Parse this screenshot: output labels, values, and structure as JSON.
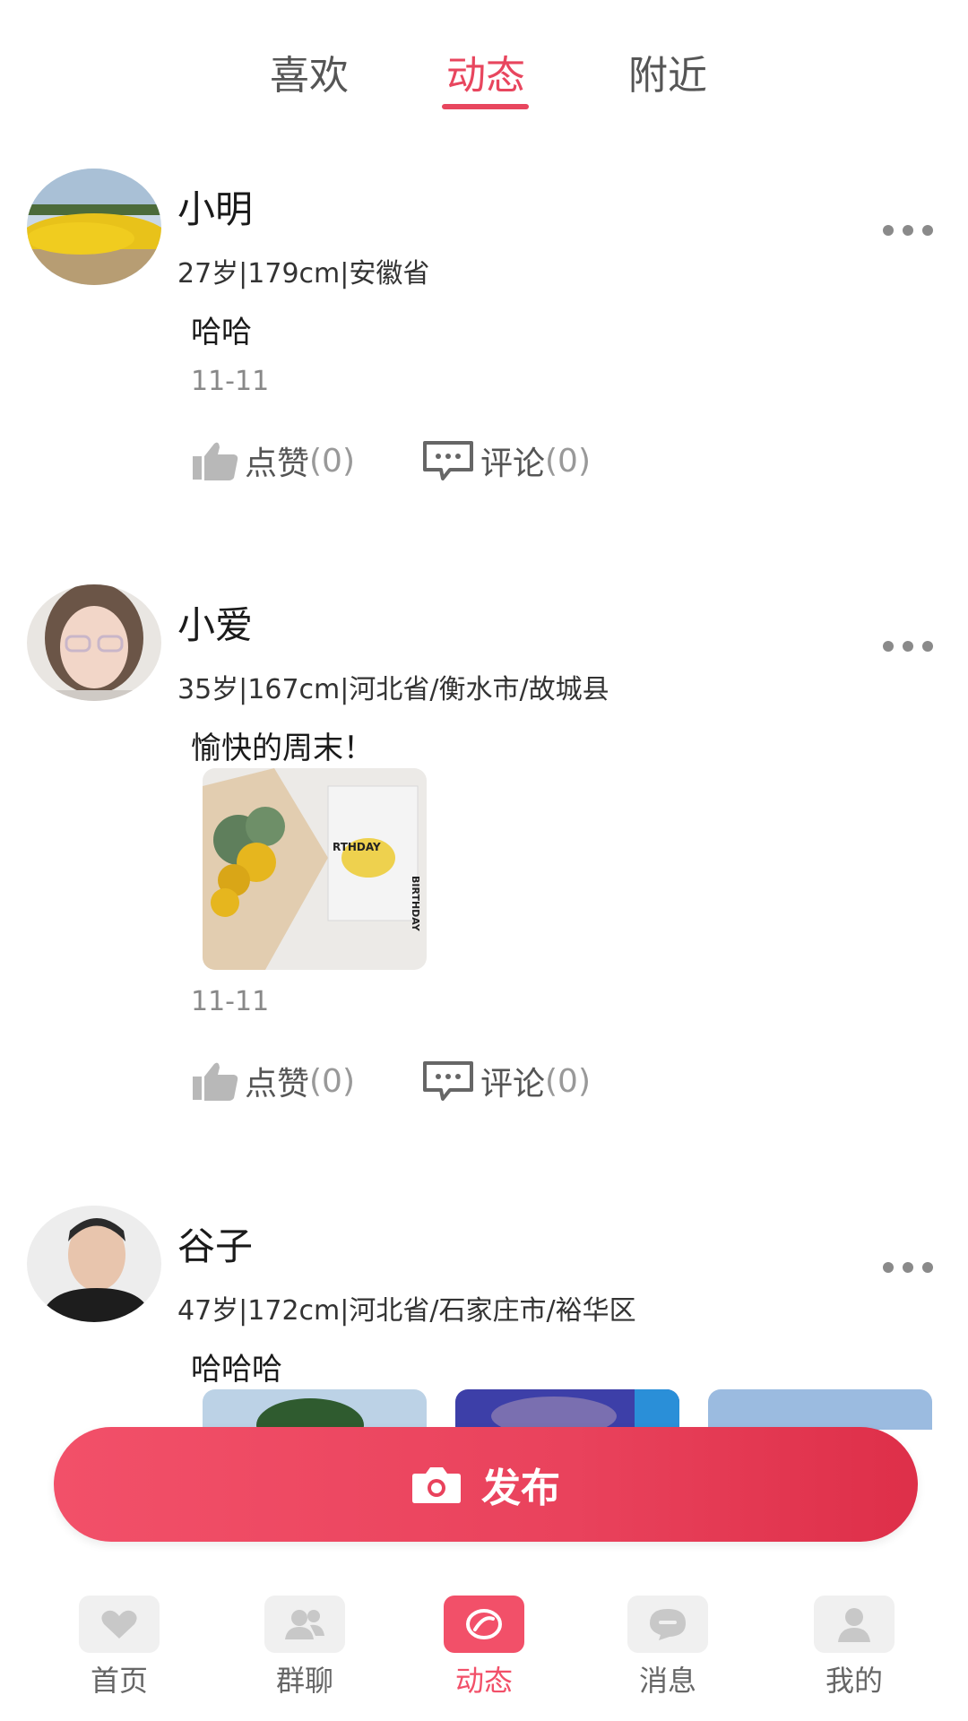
{
  "tabs": [
    {
      "label": "喜欢"
    },
    {
      "label": "动态"
    },
    {
      "label": "附近"
    }
  ],
  "active_tab": "动态",
  "posts": [
    {
      "name": "小明",
      "info": "27岁|179cm|安徽省",
      "text": "哈哈",
      "date": "11-11",
      "like_label": "点赞",
      "like_count": "(0)",
      "comment_label": "评论",
      "comment_count": "(0)"
    },
    {
      "name": "小爱",
      "info": "35岁|167cm|河北省/衡水市/故城县",
      "text": "愉快的周末！",
      "date": "11-11",
      "like_label": "点赞",
      "like_count": "(0)",
      "comment_label": "评论",
      "comment_count": "(0)",
      "photo_text": [
        "RTHDAY",
        "BIRTHDAY"
      ]
    },
    {
      "name": "谷子",
      "info": "47岁|172cm|河北省/石家庄市/裕华区",
      "text": "哈哈哈"
    }
  ],
  "publish": {
    "label": "发布",
    "icon": "camera-icon"
  },
  "nav": [
    {
      "label": "首页",
      "icon": "heart-icon"
    },
    {
      "label": "群聊",
      "icon": "group-icon"
    },
    {
      "label": "动态",
      "icon": "feed-icon"
    },
    {
      "label": "消息",
      "icon": "message-icon"
    },
    {
      "label": "我的",
      "icon": "profile-icon"
    }
  ],
  "colors": {
    "accent": "#e8465e",
    "publish_gradient_end": "#de2f49"
  }
}
